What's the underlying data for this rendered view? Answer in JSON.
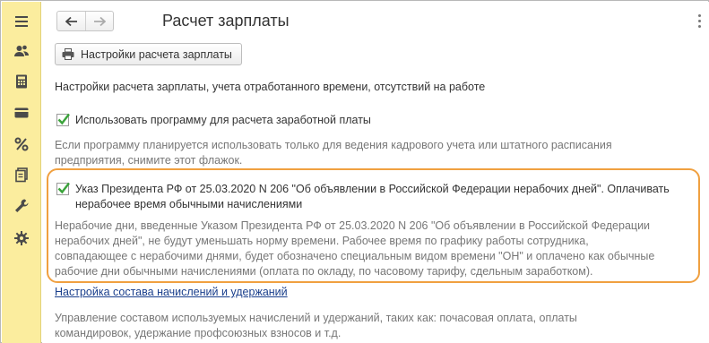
{
  "window": {
    "title": "Расчет зарплаты"
  },
  "sidebar": {
    "icons": [
      "menu-icon",
      "users-icon",
      "calculator-icon",
      "card-icon",
      "percent-icon",
      "documents-icon",
      "wrench-icon",
      "gear-icon"
    ]
  },
  "nav": {
    "back_icon": "arrow-left-icon",
    "forward_icon": "arrow-right-icon"
  },
  "toolbar": {
    "settings_button_label": "Настройки расчета зарплаты"
  },
  "content": {
    "section_caption": "Настройки расчета зарплаты, учета отработанного времени, отсутствий на работе",
    "use_program": {
      "checked": true,
      "label": "Использовать программу для расчета заработной платы",
      "hint_line1": "Если программу планируется использовать только для ведения кадрового учета или штатного расписания",
      "hint_line2": "предприятия, снимите этот флажок."
    },
    "decree": {
      "checked": true,
      "label_line1": "Указ Президента РФ от 25.03.2020 N 206 \"Об объявлении в Российской Федерации нерабочих дней\". Оплачивать",
      "label_line2": "нерабочее время обычными начислениями",
      "hint_line1": "Нерабочие дни, введенные Указом Президента РФ от 25.03.2020 N 206 \"Об объявлении в Российской Федерации",
      "hint_line2": "нерабочих дней\", не будут уменьшать норму времени. Рабочее время по графику работы сотрудника,",
      "hint_line3": "совпадающее с нерабочими днями, будет обозначено специальным видом времени \"ОН\" и оплачено как обычные",
      "hint_line4": "рабочие дни обычными начислениями (оплата по окладу, по часовому тарифу, сдельным заработком)."
    },
    "accruals_link": "Настройка состава начислений и удержаний",
    "accruals_hint_line1": "Управление составом используемых начислений и удержаний, таких как: почасовая оплата, оплаты",
    "accruals_hint_line2": "командировок, удержание профсоюзных взносов и т.д."
  },
  "colors": {
    "sidebar": "#fbed9e",
    "highlight": "#f0a040",
    "check": "#3aa33a",
    "link": "#1a3f8c",
    "hint": "#777777"
  }
}
